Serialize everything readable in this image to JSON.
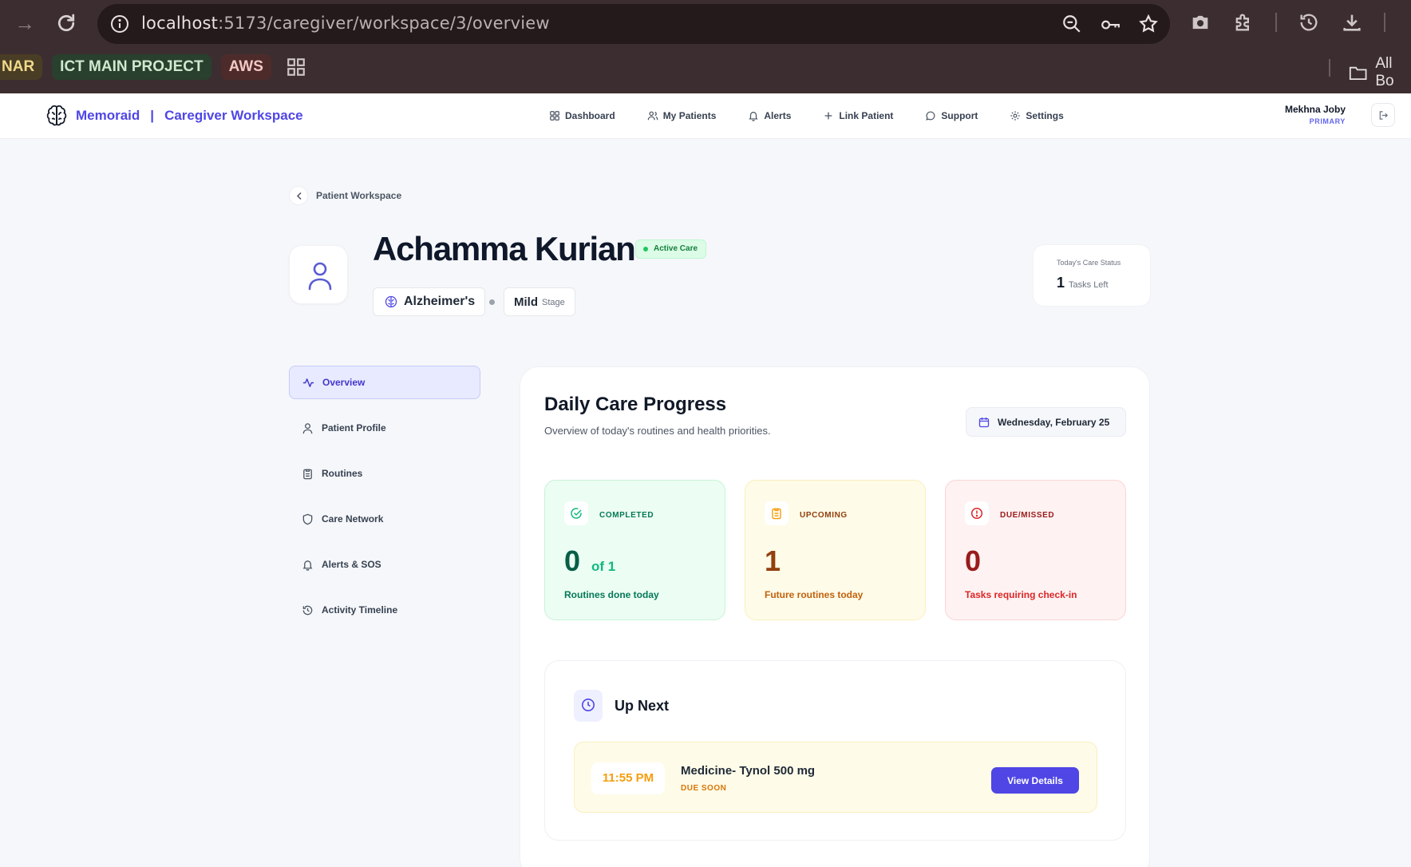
{
  "browser": {
    "url_host": "localhost",
    "url_path": ":5173/caregiver/workspace/3/overview",
    "bookmarks": [
      "NAR",
      "ICT MAIN PROJECT",
      "AWS"
    ],
    "bookmarks_folder": "All Bo"
  },
  "app": {
    "brand": "Memoraid",
    "brand_section": "Caregiver Workspace",
    "nav": [
      "Dashboard",
      "My Patients",
      "Alerts",
      "Link Patient",
      "Support",
      "Settings"
    ],
    "user": {
      "name": "Mekhna Joby",
      "role": "PRIMARY"
    }
  },
  "patient": {
    "breadcrumb": "Patient Workspace",
    "name": "Achamma Kurian",
    "status_badge": "Active Care",
    "diagnosis": "Alzheimer's",
    "stage_value": "Mild",
    "stage_label": "Stage",
    "care_status": {
      "title": "Today's Care Status",
      "count": "1",
      "unit": "Tasks Left"
    }
  },
  "sidebar": {
    "items": [
      {
        "label": "Overview",
        "icon": "activity-icon",
        "active": true
      },
      {
        "label": "Patient Profile",
        "icon": "user-icon"
      },
      {
        "label": "Routines",
        "icon": "clipboard-icon"
      },
      {
        "label": "Care Network",
        "icon": "shield-icon"
      },
      {
        "label": "Alerts & SOS",
        "icon": "bell-icon"
      },
      {
        "label": "Activity Timeline",
        "icon": "history-icon"
      }
    ]
  },
  "overview": {
    "title": "Daily Care Progress",
    "subtitle": "Overview of today's routines and health priorities.",
    "date": "Wednesday, February 25",
    "stats": {
      "completed": {
        "label": "COMPLETED",
        "value": "0",
        "of": "of 1",
        "desc": "Routines done today",
        "color": "#047857"
      },
      "upcoming": {
        "label": "UPCOMING",
        "value": "1",
        "desc": "Future routines today",
        "color": "#92400e"
      },
      "due": {
        "label": "DUE/MISSED",
        "value": "0",
        "desc": "Tasks requiring check-in",
        "color": "#991b1b"
      }
    },
    "up_next": {
      "title": "Up Next",
      "time": "11:55 PM",
      "task": "Medicine- Tynol 500 mg",
      "flag": "DUE SOON",
      "button": "View Details"
    }
  },
  "colors": {
    "accent": "#4f46e5",
    "chrome": "#3c2e30"
  }
}
